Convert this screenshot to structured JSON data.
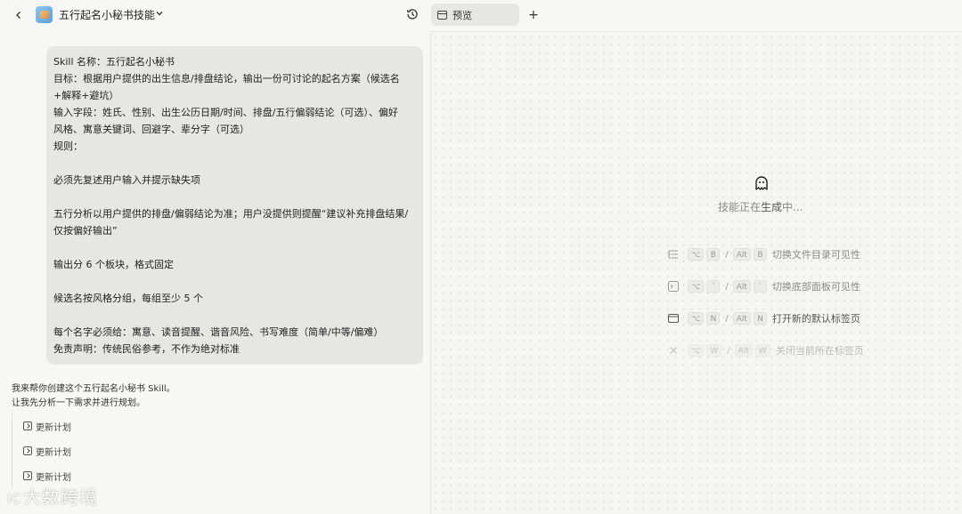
{
  "header": {
    "title": "五行起名小秘书技能",
    "preview_tab": "预览"
  },
  "user_message": {
    "lines": [
      "Skill 名称：五行起名小秘书",
      "目标：根据用户提供的出生信息/排盘结论，输出一份可讨论的起名方案（候选名",
      "+解释+避坑）",
      "输入字段：姓氏、性别、出生公历日期/时间、排盘/五行偏弱结论（可选）、偏好",
      "风格、寓意关键词、回避字、辈分字（可选）",
      "规则：",
      "",
      "必须先复述用户输入并提示缺失项",
      "",
      "五行分析以用户提供的排盘/偏弱结论为准；用户没提供则提醒“建议补充排盘结果/",
      "仅按偏好输出”",
      "",
      "输出分 6 个板块，格式固定",
      "",
      "候选名按风格分组，每组至少 5 个",
      "",
      "每个名字必须给：寓意、读音提醒、谐音风险、书写难度（简单/中等/偏难）",
      "免责声明：传统民俗参考，不作为绝对标准"
    ]
  },
  "assistant_reply": {
    "line1": "我来帮你创建这个五行起名小秘书 Skill。",
    "line2": "让我先分析一下需求并进行规划。"
  },
  "plan_steps": [
    {
      "label": "更新计划"
    },
    {
      "label": "更新计划"
    },
    {
      "label": "更新计划"
    }
  ],
  "watermark": {
    "text": "大数跨境",
    "logo": "IC"
  },
  "preview": {
    "status_pre": "技能正在",
    "status_highlight": "生成",
    "status_post": "中...",
    "shortcuts": [
      {
        "icon": "file-tree-icon",
        "mac_keys": [
          "⌥",
          "B"
        ],
        "alt_keys": [
          "Alt",
          "B"
        ],
        "label": "切换文件目录可见性"
      },
      {
        "icon": "terminal-panel-icon",
        "mac_keys": [
          "⌥",
          "`"
        ],
        "alt_keys": [
          "Alt",
          "`"
        ],
        "label": "切换底部面板可见性"
      },
      {
        "icon": "browser-tab-icon",
        "mac_keys": [
          "⌥",
          "N"
        ],
        "alt_keys": [
          "Alt",
          "N"
        ],
        "label": "打开新的默认标签页"
      },
      {
        "icon": "close-icon",
        "mac_keys": [
          "⌥",
          "W"
        ],
        "alt_keys": [
          "Alt",
          "W"
        ],
        "label": "关闭当前所在标签页"
      }
    ]
  }
}
